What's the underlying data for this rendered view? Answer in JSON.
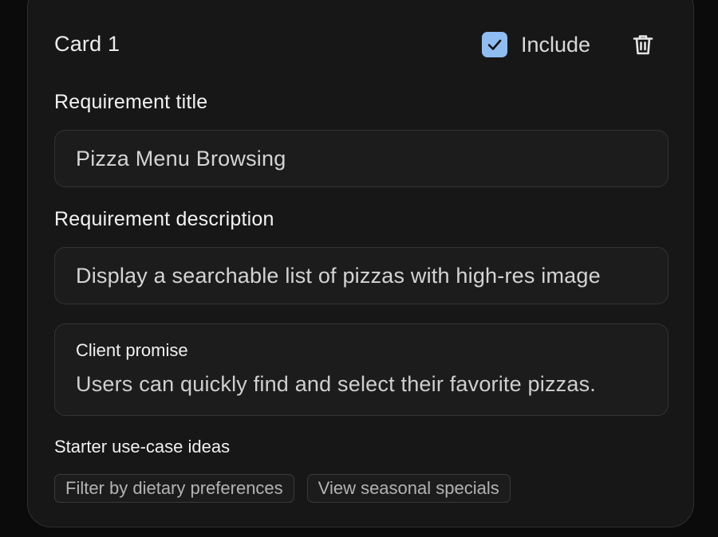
{
  "card": {
    "title": "Card 1",
    "include_label": "Include",
    "include_checked": true,
    "accent_color": "#8fbdf2",
    "delete_icon": "trash-icon"
  },
  "requirement_title": {
    "label": "Requirement title",
    "value": "Pizza Menu Browsing"
  },
  "requirement_description": {
    "label": "Requirement description",
    "value": "Display a searchable list of pizzas with high-res image"
  },
  "client_promise": {
    "label": "Client promise",
    "value": "Users can quickly find and select their favorite pizzas."
  },
  "starter_ideas": {
    "label": "Starter use-case ideas",
    "chips": [
      "Filter by dietary preferences",
      "View seasonal specials"
    ]
  }
}
